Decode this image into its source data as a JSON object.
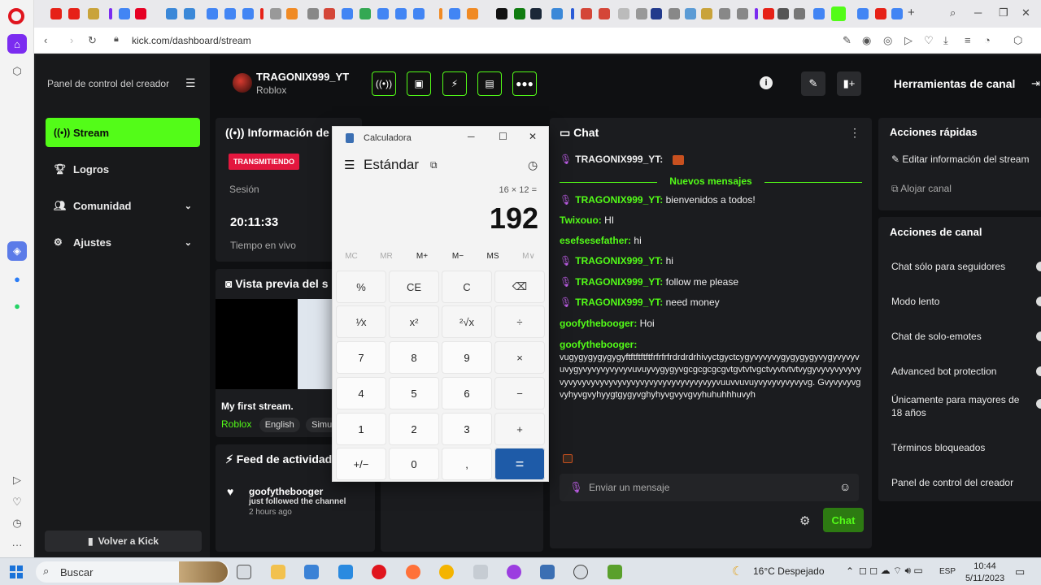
{
  "browser": {
    "url": "kick.com/dashboard/stream"
  },
  "nav": {
    "title": "Panel de control del creador",
    "items": [
      {
        "label": "Stream"
      },
      {
        "label": "Logros"
      },
      {
        "label": "Comunidad"
      },
      {
        "label": "Ajustes"
      }
    ],
    "back_label": "Volver a Kick"
  },
  "header": {
    "username": "TRAGONIX999_YT",
    "game": "Roblox",
    "tools_title": "Herramientas de canal"
  },
  "stream_info": {
    "title": "Información de se",
    "badge": "TRANSMITIENDO",
    "session_label": "Sesión",
    "time": "20:11:33",
    "time_label": "Tiempo en vivo"
  },
  "preview": {
    "title": "Vista previa del s",
    "stream_title": "My first stream.",
    "category": "Roblox",
    "tags": [
      "English",
      "Simula"
    ]
  },
  "feed": {
    "title": "Feed de actividad",
    "user": "goofythebooger",
    "action": "just followed the channel",
    "ago": "2 hours ago"
  },
  "chat": {
    "title": "Chat",
    "new_messages": "Nuevos mensajes",
    "messages": [
      {
        "user": "TRAGONIX999_YT:",
        "text": "",
        "mic": true
      },
      {
        "user": "TRAGONIX999_YT:",
        "text": "bienvenidos a todos!",
        "mic": true
      },
      {
        "user": "Twixouo:",
        "text": "HI",
        "mic": false
      },
      {
        "user": "esefsesefather:",
        "text": "hi",
        "mic": false
      },
      {
        "user": "TRAGONIX999_YT:",
        "text": "hi",
        "mic": true
      },
      {
        "user": "TRAGONIX999_YT:",
        "text": "follow me please",
        "mic": true
      },
      {
        "user": "TRAGONIX999_YT:",
        "text": "need money",
        "mic": true
      },
      {
        "user": "goofythebooger:",
        "text": "Hoi",
        "mic": false
      },
      {
        "user": "goofythebooger:",
        "text": "vugygygygygygyftftftftftfrfrfrfrdrdrdrhivyctgyctcygyvyvyvygygygygyvygyvyvyvuvygyvyvyvyvyvyvuvuyvygygyvgcgcgcgcgvtgvtvtvgctvyvtvtvtvygyvyvyvyvyvyvyvyvyvyvyvyvyvyvyvyvyvyvyvyvyvyvyyvuuvvuvuyvyvyvyvyvyvg. Gvyvyvyvgvyhyvgvyhyygtgygyvghyhyvgvyvgvyhuhuhhhuvyh",
        "mic": false
      }
    ],
    "input_placeholder": "Enviar un mensaje",
    "send_label": "Chat"
  },
  "tools": {
    "quick_title": "Acciones rápidas",
    "quick_items": [
      "Editar información del stream",
      "Alojar canal"
    ],
    "channel_title": "Acciones de canal",
    "channel_items": [
      "Chat sólo para seguidores",
      "Modo lento",
      "Chat de solo-emotes",
      "Advanced bot protection",
      "Únicamente para mayores de 18 años",
      "Términos bloqueados",
      "Panel de control del creador"
    ]
  },
  "calculator": {
    "window_title": "Calculadora",
    "mode": "Estándar",
    "expression": "16 × 12 =",
    "result": "192",
    "memory": [
      "MC",
      "MR",
      "M+",
      "M−",
      "MS",
      "M∨"
    ],
    "keys": [
      "%",
      "CE",
      "C",
      "⌫",
      "¹⁄x",
      "x²",
      "²√x",
      "÷",
      "7",
      "8",
      "9",
      "×",
      "4",
      "5",
      "6",
      "−",
      "1",
      "2",
      "3",
      "+",
      "+/−",
      "0",
      ",",
      "="
    ]
  },
  "taskbar": {
    "search_placeholder": "Buscar",
    "weather": "16°C  Despejado",
    "lang": "ESP",
    "time": "10:44",
    "date": "5/11/2023"
  }
}
